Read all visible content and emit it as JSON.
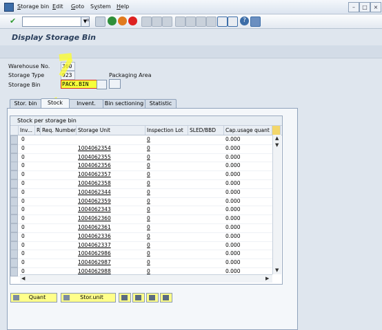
{
  "menu": [
    "Storage bin",
    "Edit",
    "Goto",
    "System",
    "Help"
  ],
  "menu_underline": [
    "S",
    "E",
    "G",
    "y",
    "H"
  ],
  "toolbar": {
    "command_value": "",
    "nav_symbol": "«"
  },
  "title": "Display Storage Bin",
  "header": {
    "warehouse_label": "Warehouse No.",
    "warehouse_value": "360",
    "storage_type_label": "Storage Type",
    "storage_type_value": "923",
    "storage_type_desc": "Packaging Area",
    "storage_bin_label": "Storage Bin",
    "storage_bin_value": "PACK.BIN"
  },
  "tabs": [
    "Stor. bin",
    "Stock",
    "Invent.",
    "Bin sectioning",
    "Statistic"
  ],
  "active_tab": "Stock",
  "table": {
    "title": "Stock per storage bin",
    "columns": [
      "Inv...",
      "R",
      "Req. Number",
      "Storage Unit",
      "Inspection Lot",
      "SLED/BBD",
      "Cap.usage quant"
    ],
    "rows": [
      {
        "inv": "0",
        "su": "",
        "lot": "0",
        "cap": "0.000"
      },
      {
        "inv": "0",
        "su": "1004062354",
        "lot": "0",
        "cap": "0.000"
      },
      {
        "inv": "0",
        "su": "1004062355",
        "lot": "0",
        "cap": "0.000"
      },
      {
        "inv": "0",
        "su": "1004062356",
        "lot": "0",
        "cap": "0.000"
      },
      {
        "inv": "0",
        "su": "1004062357",
        "lot": "0",
        "cap": "0.000"
      },
      {
        "inv": "0",
        "su": "1004062358",
        "lot": "0",
        "cap": "0.000"
      },
      {
        "inv": "0",
        "su": "1004062344",
        "lot": "0",
        "cap": "0.000"
      },
      {
        "inv": "0",
        "su": "1004062359",
        "lot": "0",
        "cap": "0.000"
      },
      {
        "inv": "0",
        "su": "1004062343",
        "lot": "0",
        "cap": "0.000"
      },
      {
        "inv": "0",
        "su": "1004062360",
        "lot": "0",
        "cap": "0.000"
      },
      {
        "inv": "0",
        "su": "1004062361",
        "lot": "0",
        "cap": "0.000"
      },
      {
        "inv": "0",
        "su": "1004062336",
        "lot": "0",
        "cap": "0.000"
      },
      {
        "inv": "0",
        "su": "1004062337",
        "lot": "0",
        "cap": "0.000"
      },
      {
        "inv": "0",
        "su": "1004062986",
        "lot": "0",
        "cap": "0.000"
      },
      {
        "inv": "0",
        "su": "1004062987",
        "lot": "0",
        "cap": "0.000"
      },
      {
        "inv": "0",
        "su": "1004062988",
        "lot": "0",
        "cap": "0.000"
      }
    ]
  },
  "buttons": {
    "quant": "Quant",
    "stor_unit": "Stor.unit"
  },
  "colors": {
    "highlight": "#f5ff3a",
    "title": "#2a3f5c",
    "accent": "#3c6da8"
  }
}
